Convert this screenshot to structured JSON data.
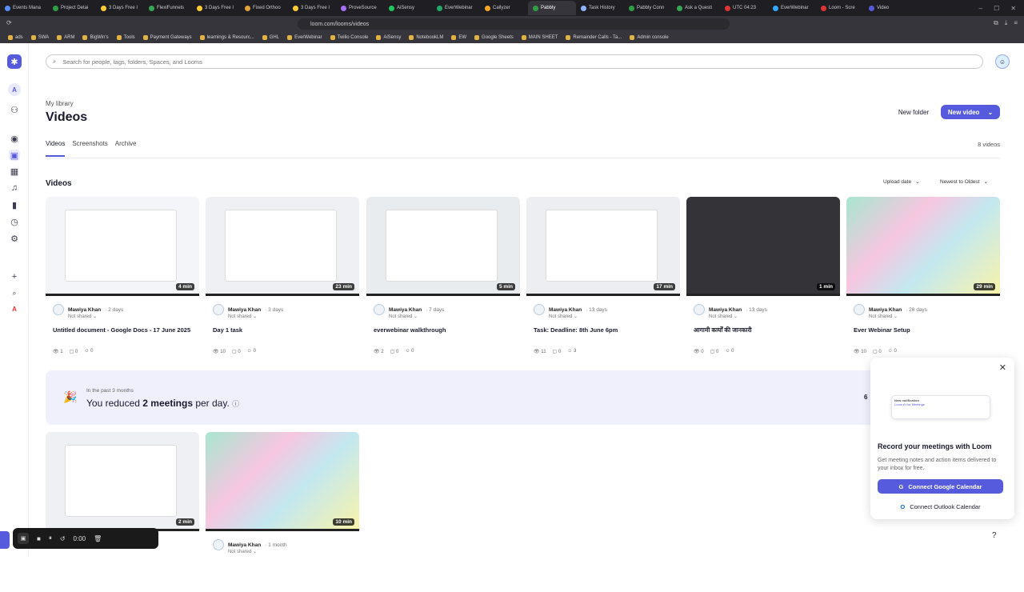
{
  "browser": {
    "tabs": [
      "Events Mana",
      "Project Detai",
      "3 Days Free I",
      "FlexiFunnels",
      "3 Days Free I",
      "Fixed Orthoo",
      "3 Days Free I",
      "ProveSource",
      "AiSensy",
      "EverWebinar",
      "Callyzer",
      "Pabbly",
      "Task History",
      "Pabbly Conn",
      "Ask a Questi",
      "UTC 04:23",
      "EverWebinar",
      "Loom - Scre",
      "Video"
    ],
    "url": "loom.com/looms/videos",
    "bookmarks": [
      "ads",
      "SWA",
      "ARM",
      "BigWin's",
      "Tools",
      "Payment Gateways",
      "learnings & Resourc...",
      "GHL",
      "EverWebinar",
      "Twilio Console",
      "AiSensy",
      "NotebookLM",
      "EW",
      "Google Sheets",
      "MAIN SHEET",
      "Remainder Calls - Ta...",
      "Admin console"
    ]
  },
  "sidebar": {
    "workspace_initial": "A",
    "recorder_initial": "A"
  },
  "search": {
    "placeholder": "Search for people, tags, folders, Spaces, and Looms"
  },
  "header": {
    "breadcrumb": "My library",
    "title": "Videos",
    "new_folder": "New folder",
    "new_video": "New video"
  },
  "tabs": [
    "Videos",
    "Screenshots",
    "Archive"
  ],
  "video_count": "8 videos",
  "section_title": "Videos",
  "sort": {
    "field": "Upload date",
    "order": "Newest to Oldest"
  },
  "videos": [
    {
      "duration": "4 min",
      "author": "Mawiya Khan",
      "ago": "· 2 days",
      "shared": "Not shared",
      "title": "Untitled document - Google Docs - 17 June 2025",
      "views": "1",
      "comments": "0",
      "reactions": "0",
      "thumb": "#f3f5f8"
    },
    {
      "duration": "23 min",
      "author": "Mawiya Khan",
      "ago": "· 3 days",
      "shared": "Not shared",
      "title": "Day 1 task",
      "views": "10",
      "comments": "0",
      "reactions": "0",
      "thumb": "#eef0f4"
    },
    {
      "duration": "5 min",
      "author": "Mawiya Khan",
      "ago": "· 7 days",
      "shared": "Not shared",
      "title": "everwebinar walkthrough",
      "views": "2",
      "comments": "0",
      "reactions": "0",
      "thumb": "#e9ecef"
    },
    {
      "duration": "17 min",
      "author": "Mawiya Khan",
      "ago": "· 13 days",
      "shared": "Not shared",
      "title": "Task: Deadline: 8th June 6pm",
      "views": "11",
      "comments": "0",
      "reactions": "3",
      "thumb": "#eceef2"
    },
    {
      "duration": "1 min",
      "author": "Mawiya Khan",
      "ago": "· 13 days",
      "shared": "Not shared",
      "title": "आगामी कार्यों की जानकारी",
      "views": "0",
      "comments": "0",
      "reactions": "0",
      "thumb": "#333338"
    },
    {
      "duration": "29 min",
      "author": "Mawiya Khan",
      "ago": "· 26 days",
      "shared": "Not shared",
      "title": "Ever Webinar Setup",
      "views": "10",
      "comments": "0",
      "reactions": "0",
      "thumb": "gradient"
    },
    {
      "duration": "2 min",
      "author": "",
      "ago": "",
      "shared": "",
      "title": "",
      "views": "",
      "comments": "",
      "reactions": "",
      "thumb": "#eef0f4"
    },
    {
      "duration": "10 min",
      "author": "Mawiya Khan",
      "ago": "· 1 month",
      "shared": "Not shared",
      "title": "",
      "views": "",
      "comments": "",
      "reactions": "",
      "thumb": "gradient"
    }
  ],
  "banner": {
    "pre": "In the past 3 months",
    "main_prefix": "You reduced ",
    "main_bold": "2 meetings",
    "main_suffix": " per day.",
    "truncated": "6"
  },
  "popup": {
    "illus_title": "New notification",
    "illus_text": "Loom AI for Meetings",
    "title": "Record your meetings with Loom",
    "body": "Get meeting notes and action items delivered to your inbox for free.",
    "google_btn": "Connect Google Calendar",
    "outlook_btn": "Connect Outlook Calendar"
  },
  "recorder": {
    "time": "0:00"
  },
  "colors": {
    "accent": "#565add",
    "banner_bg": "#f0f0fd"
  }
}
